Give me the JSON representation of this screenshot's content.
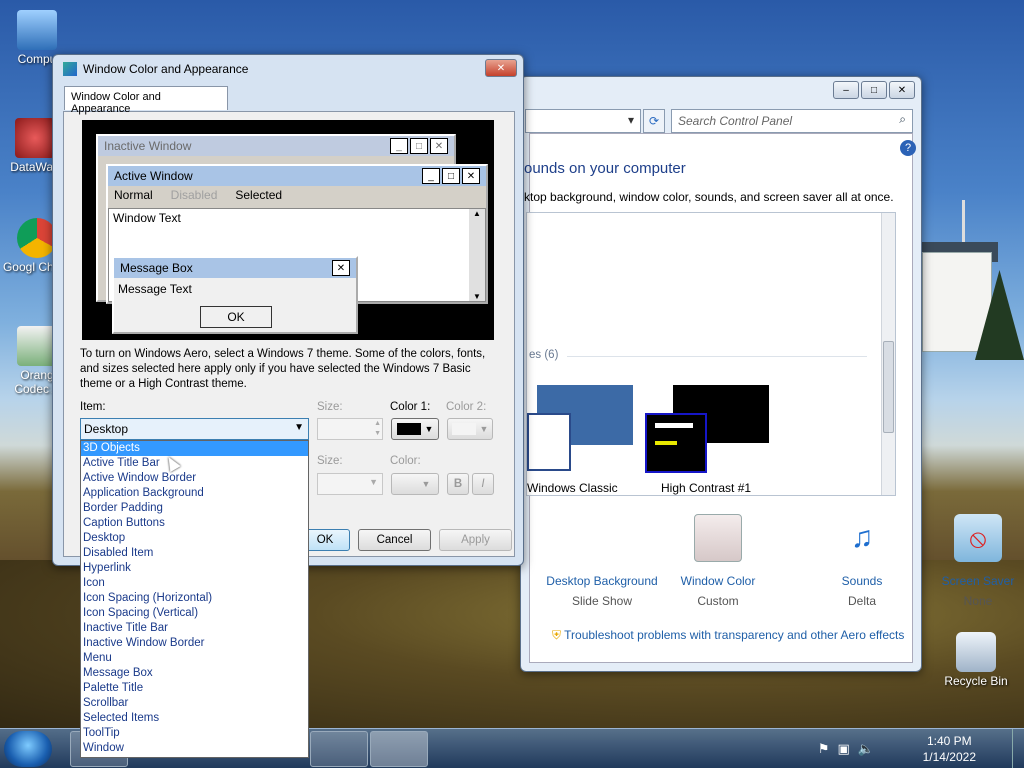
{
  "desktop": {
    "icons": [
      {
        "label": "Compu"
      },
      {
        "label": "DataWag"
      },
      {
        "label": "Googl Chron"
      },
      {
        "label": "Orang Codec A"
      },
      {
        "label": "Recycle Bin"
      }
    ]
  },
  "control_panel": {
    "search_placeholder": "Search Control Panel",
    "heading": "ounds on your computer",
    "subheading": "ktop background, window color, sounds, and screen saver all at once.",
    "themes_group_label": "es (6)",
    "themes": [
      {
        "label": "Windows Classic"
      },
      {
        "label": "High Contrast #1"
      }
    ],
    "bottom_items": [
      {
        "title": "Desktop Background",
        "sub": "Slide Show"
      },
      {
        "title": "Window Color",
        "sub": "Custom"
      },
      {
        "title": "Sounds",
        "sub": "Delta"
      },
      {
        "title": "Screen Saver",
        "sub": "None"
      }
    ],
    "troubleshoot": "Troubleshoot problems with transparency and other Aero effects"
  },
  "dialog": {
    "title": "Window Color and Appearance",
    "tab": "Window Color and Appearance",
    "preview": {
      "inactive_title": "Inactive Window",
      "active_title": "Active Window",
      "menu_normal": "Normal",
      "menu_disabled": "Disabled",
      "menu_selected": "Selected",
      "window_text": "Window Text",
      "msgbox_title": "Message Box",
      "msgbox_text": "Message Text",
      "ok": "OK"
    },
    "info": "To turn on Windows Aero, select a Windows 7 theme.  Some of the colors, fonts, and sizes selected here apply only if you have selected the Windows 7 Basic theme or a High Contrast theme.",
    "item_label": "Item:",
    "item_value": "Desktop",
    "size_label": "Size:",
    "color1_label": "Color 1:",
    "color2_label": "Color 2:",
    "font_size_label": "Size:",
    "font_color_label": "Color:",
    "bold": "B",
    "italic": "I",
    "ok": "OK",
    "cancel": "Cancel",
    "apply": "Apply",
    "options": [
      "3D Objects",
      "Active Title Bar",
      "Active Window Border",
      "Application Background",
      "Border Padding",
      "Caption Buttons",
      "Desktop",
      "Disabled Item",
      "Hyperlink",
      "Icon",
      "Icon Spacing (Horizontal)",
      "Icon Spacing (Vertical)",
      "Inactive Title Bar",
      "Inactive Window Border",
      "Menu",
      "Message Box",
      "Palette Title",
      "Scrollbar",
      "Selected Items",
      "ToolTip",
      "Window"
    ],
    "highlighted_option": "3D Objects"
  },
  "taskbar": {
    "time": "1:40 PM",
    "date": "1/14/2022"
  },
  "colors": {
    "accent": "#3399ff",
    "link": "#1f5fa8",
    "active_title": "#a9c4e6",
    "inactive_title": "#c7d3e0"
  }
}
